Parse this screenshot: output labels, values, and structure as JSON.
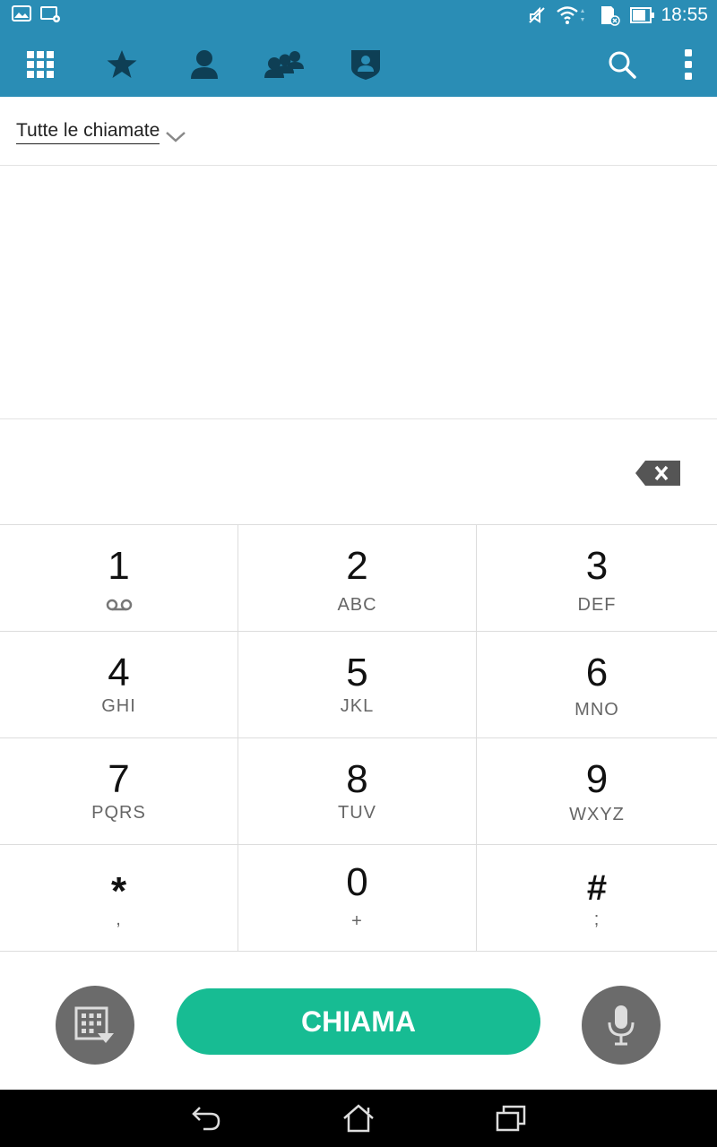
{
  "status_bar": {
    "time": "18:55",
    "icons": [
      "gallery-icon",
      "screen-settings-icon",
      "muted-icon",
      "wifi-icon",
      "sd-card-icon",
      "battery-icon"
    ]
  },
  "action_bar": {
    "tabs": [
      "dialpad-tab-icon",
      "favorites-star-icon",
      "contact-icon",
      "groups-icon",
      "protected-contact-icon"
    ],
    "actions": [
      "search-icon",
      "overflow-menu-icon"
    ],
    "accent_color": "#2a8db5"
  },
  "filter": {
    "label": "Tutte le chiamate"
  },
  "keypad": {
    "keys": [
      {
        "num": "1",
        "letters": ""
      },
      {
        "num": "2",
        "letters": "ABC"
      },
      {
        "num": "3",
        "letters": "DEF"
      },
      {
        "num": "4",
        "letters": "GHI"
      },
      {
        "num": "5",
        "letters": "JKL"
      },
      {
        "num": "6",
        "letters": "MNO"
      },
      {
        "num": "7",
        "letters": "PQRS"
      },
      {
        "num": "8",
        "letters": "TUV"
      },
      {
        "num": "9",
        "letters": "WXYZ"
      },
      {
        "num": "*",
        "letters": ","
      },
      {
        "num": "0",
        "letters": "+"
      },
      {
        "num": "#",
        "letters": ";"
      }
    ]
  },
  "bottom": {
    "call_label": "CHIAMA",
    "call_color": "#17bc93"
  },
  "nav": {
    "buttons": [
      "back-icon",
      "home-icon",
      "recents-icon"
    ]
  }
}
